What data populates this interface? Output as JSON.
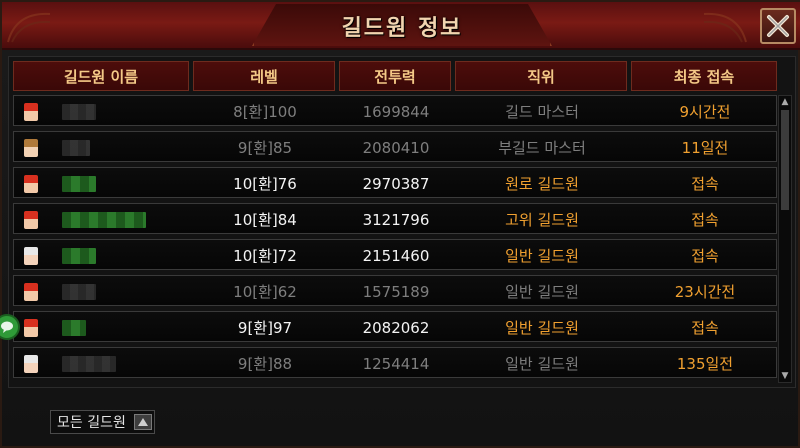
{
  "window": {
    "title": "길드원 정보"
  },
  "table": {
    "headers": [
      "길드원 이름",
      "레벨",
      "전투력",
      "직위",
      "최종 접속"
    ],
    "rows": [
      {
        "level": "8[환]100",
        "power": "1699844",
        "role": "길드 마스터",
        "last": "9시간전",
        "state": "dim",
        "name_style": "gray",
        "name_width": 34,
        "avatar": "red-hair"
      },
      {
        "level": "9[환]85",
        "power": "2080410",
        "role": "부길드 마스터",
        "last": "11일전",
        "state": "dim",
        "name_style": "gray",
        "name_width": 28,
        "avatar": "blonde"
      },
      {
        "level": "10[환]76",
        "power": "2970387",
        "role": "원로 길드원",
        "last": "접속",
        "state": "bright",
        "name_style": "green",
        "name_width": 34,
        "avatar": "red-hair"
      },
      {
        "level": "10[환]84",
        "power": "3121796",
        "role": "고위 길드원",
        "last": "접속",
        "state": "bright",
        "name_style": "green",
        "name_width": 84,
        "avatar": "red-hair"
      },
      {
        "level": "10[환]72",
        "power": "2151460",
        "role": "일반 길드원",
        "last": "접속",
        "state": "bright",
        "name_style": "green",
        "name_width": 34,
        "avatar": "white-hair"
      },
      {
        "level": "10[환]62",
        "power": "1575189",
        "role": "일반 길드원",
        "last": "23시간전",
        "state": "dim",
        "name_style": "gray",
        "name_width": 34,
        "avatar": "red-hair"
      },
      {
        "level": "9[환]97",
        "power": "2082062",
        "role": "일반 길드원",
        "last": "접속",
        "state": "bright",
        "name_style": "green",
        "name_width": 24,
        "avatar": "red-hair"
      },
      {
        "level": "9[환]88",
        "power": "1254414",
        "role": "일반 길드원",
        "last": "135일전",
        "state": "dim",
        "name_style": "gray",
        "name_width": 54,
        "avatar": "white-hair"
      }
    ]
  },
  "filter": {
    "label": "모든 길드원"
  },
  "icons": {
    "close": "close-x-icon",
    "chat": "chat-bubble-icon",
    "filter_arrow": "triangle-up-icon",
    "scroll_up": "triangle-up-icon",
    "scroll_down": "triangle-down-icon"
  },
  "colors": {
    "accent_orange": "#f0a030",
    "header_red": "#4d0d0b",
    "online_name": "#2b7a2b"
  }
}
